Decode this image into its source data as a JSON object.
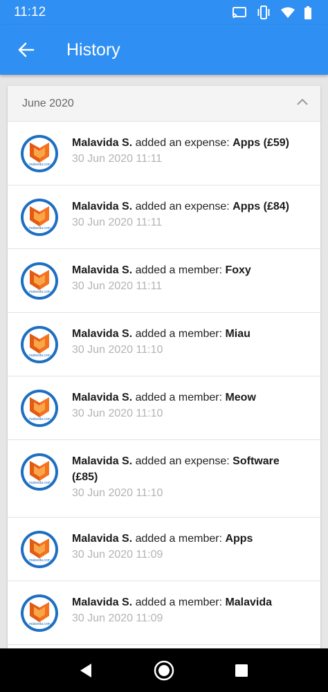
{
  "status_bar": {
    "time": "11:12"
  },
  "app_bar": {
    "title": "History"
  },
  "section": {
    "title": "June 2020"
  },
  "items": [
    {
      "actor": "Malavida S.",
      "action": " added an expense: ",
      "subject": "Apps (£59)",
      "date": "30 Jun 2020 11:11"
    },
    {
      "actor": "Malavida S.",
      "action": " added an expense: ",
      "subject": "Apps (£84)",
      "date": "30 Jun 2020 11:11"
    },
    {
      "actor": "Malavida S.",
      "action": " added a member: ",
      "subject": "Foxy",
      "date": "30 Jun 2020 11:11"
    },
    {
      "actor": "Malavida S.",
      "action": " added a member: ",
      "subject": "Miau",
      "date": "30 Jun 2020 11:10"
    },
    {
      "actor": "Malavida S.",
      "action": " added a member: ",
      "subject": "Meow",
      "date": "30 Jun 2020 11:10"
    },
    {
      "actor": "Malavida S.",
      "action": " added an expense: ",
      "subject": "Software (£85)",
      "date": "30 Jun 2020 11:10"
    },
    {
      "actor": "Malavida S.",
      "action": " added a member: ",
      "subject": "Apps",
      "date": "30 Jun 2020 11:09"
    },
    {
      "actor": "Malavida S.",
      "action": " added a member: ",
      "subject": "Malavida",
      "date": "30 Jun 2020 11:09"
    }
  ],
  "avatar_brand_text": "malavida.com",
  "colors": {
    "primary": "#2f8ff2",
    "avatar_blue": "#1d6fc2",
    "avatar_orange": "#f4721e"
  }
}
